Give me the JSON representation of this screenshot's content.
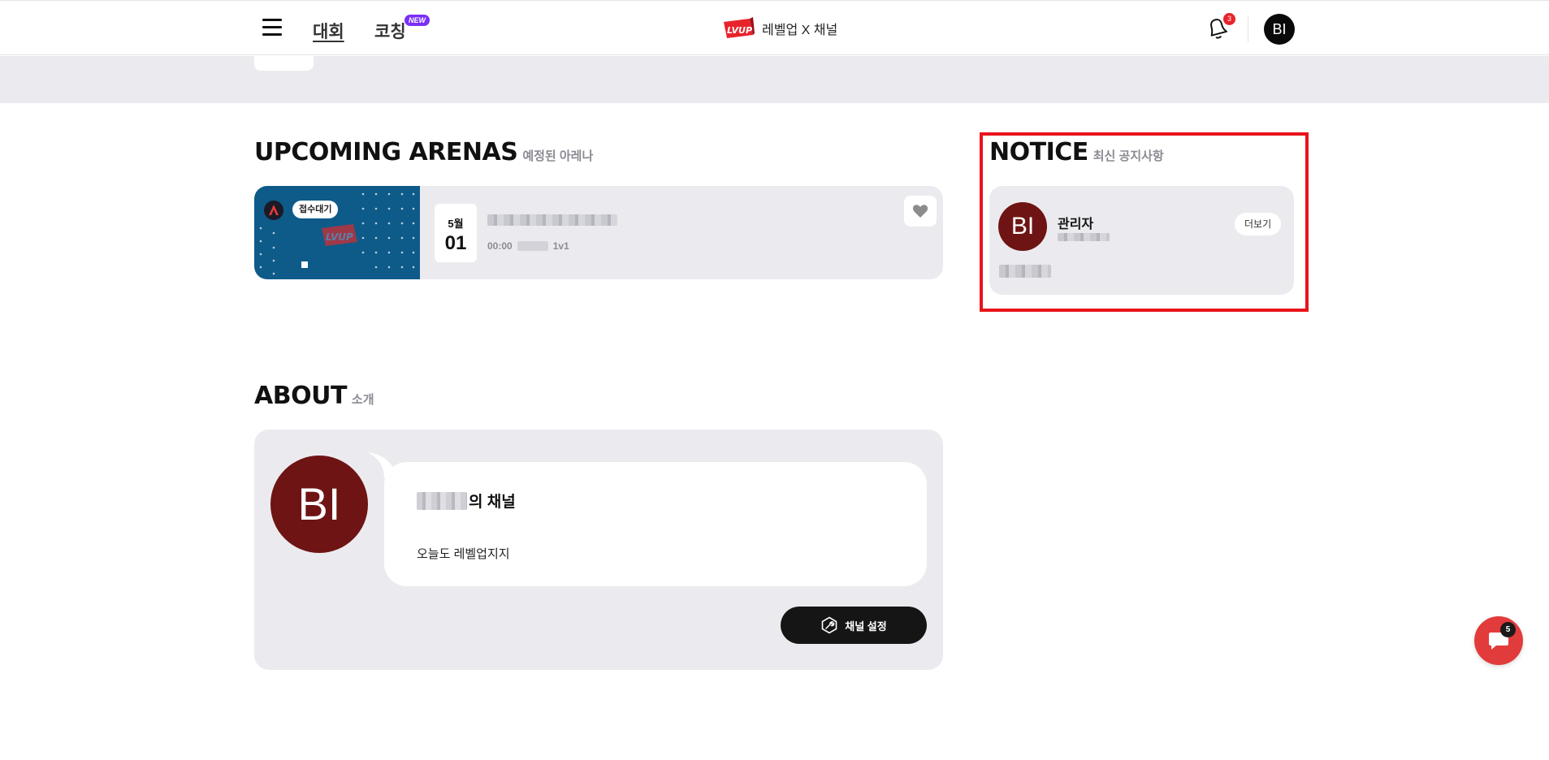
{
  "header": {
    "nav": {
      "contest_label": "대회",
      "coaching_label": "코칭",
      "new_badge": "NEW"
    },
    "brand": {
      "logo_text": "LVUP",
      "title": "레벨업 X 채널"
    },
    "notifications": {
      "count": "3",
      "icon": "bell-icon"
    },
    "avatar_initials": "BI"
  },
  "arenas": {
    "title_en": "UPCOMING ARENAS",
    "title_ko": "예정된 아레나",
    "items": [
      {
        "status": "접수대기",
        "month": "5월",
        "day": "01",
        "time": "00:00",
        "format": "1v1",
        "thumb_logo": "LVUP"
      }
    ]
  },
  "notice": {
    "title_en": "NOTICE",
    "title_ko": "최신 공지사항",
    "author_initials": "BI",
    "author": "관리자",
    "more_label": "더보기"
  },
  "about": {
    "title_en": "ABOUT",
    "title_ko": "소개",
    "avatar_initials": "BI",
    "channel_suffix": "의 채널",
    "description": "오늘도 레벨업지지",
    "settings_label": "채널 설정"
  },
  "chat": {
    "badge": "5"
  },
  "colors": {
    "accent_red": "#e8141c",
    "avatar_maroon": "#6e1414",
    "new_badge_purple": "#7b2ff7",
    "card_gray": "#ebebef",
    "arena_blue": "#0e5b8a"
  }
}
